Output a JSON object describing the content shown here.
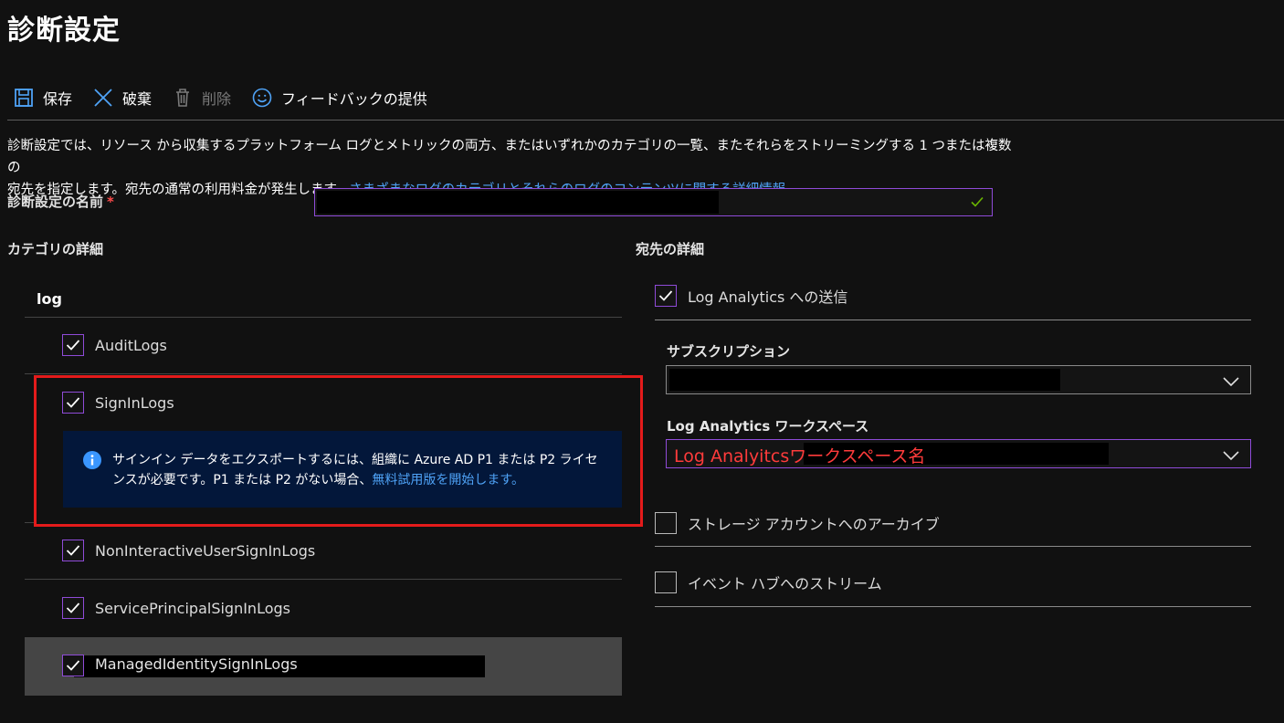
{
  "page": {
    "title": "診断設定"
  },
  "toolbar": {
    "save": "保存",
    "discard": "破棄",
    "delete": "削除",
    "feedback": "フィードバックの提供"
  },
  "description": {
    "text_line1": "診断設定では、リソース から収集するプラットフォーム ログとメトリックの両方、またはいずれかのカテゴリの一覧、またそれらをストリーミングする 1 つまたは複数の",
    "text_line2": "宛先を指定します。宛先の通常の利用料金が発生します。",
    "link": "さまざまなログのカテゴリとそれらのログのコンテンツに関する詳細情報"
  },
  "name_field": {
    "label": "診断設定の名前",
    "required_mark": "*"
  },
  "categories": {
    "heading": "カテゴリの詳細",
    "group": "log",
    "items": [
      {
        "label": "AuditLogs",
        "checked": true
      },
      {
        "label": "SignInLogs",
        "checked": true
      },
      {
        "label": "NonInteractiveUserSignInLogs",
        "checked": true
      },
      {
        "label": "ServicePrincipalSignInLogs",
        "checked": true
      },
      {
        "label": "ManagedIdentitySignInLogs",
        "checked": true
      }
    ],
    "info": {
      "text": "サインイン データをエクスポートするには、組織に Azure AD P1 または P2 ライセンスが必要です。P1 または P2 がない場合、",
      "link": "無料試用版を開始します。"
    }
  },
  "destinations": {
    "heading": "宛先の詳細",
    "log_analytics": {
      "label": "Log Analytics への送信",
      "checked": true
    },
    "subscription_label": "サブスクリプション",
    "workspace_label": "Log Analytics ワークスペース",
    "workspace_annotation": "Log Analyitcsワークスペース名",
    "storage": {
      "label": "ストレージ アカウントへのアーカイブ",
      "checked": false
    },
    "event_hub": {
      "label": "イベント ハブへのストリーム",
      "checked": false
    }
  },
  "colors": {
    "accent_purple": "#8f4bd8",
    "link_blue": "#4fa3f7",
    "highlight_red": "#e41b1b",
    "info_bg": "#03173a"
  }
}
